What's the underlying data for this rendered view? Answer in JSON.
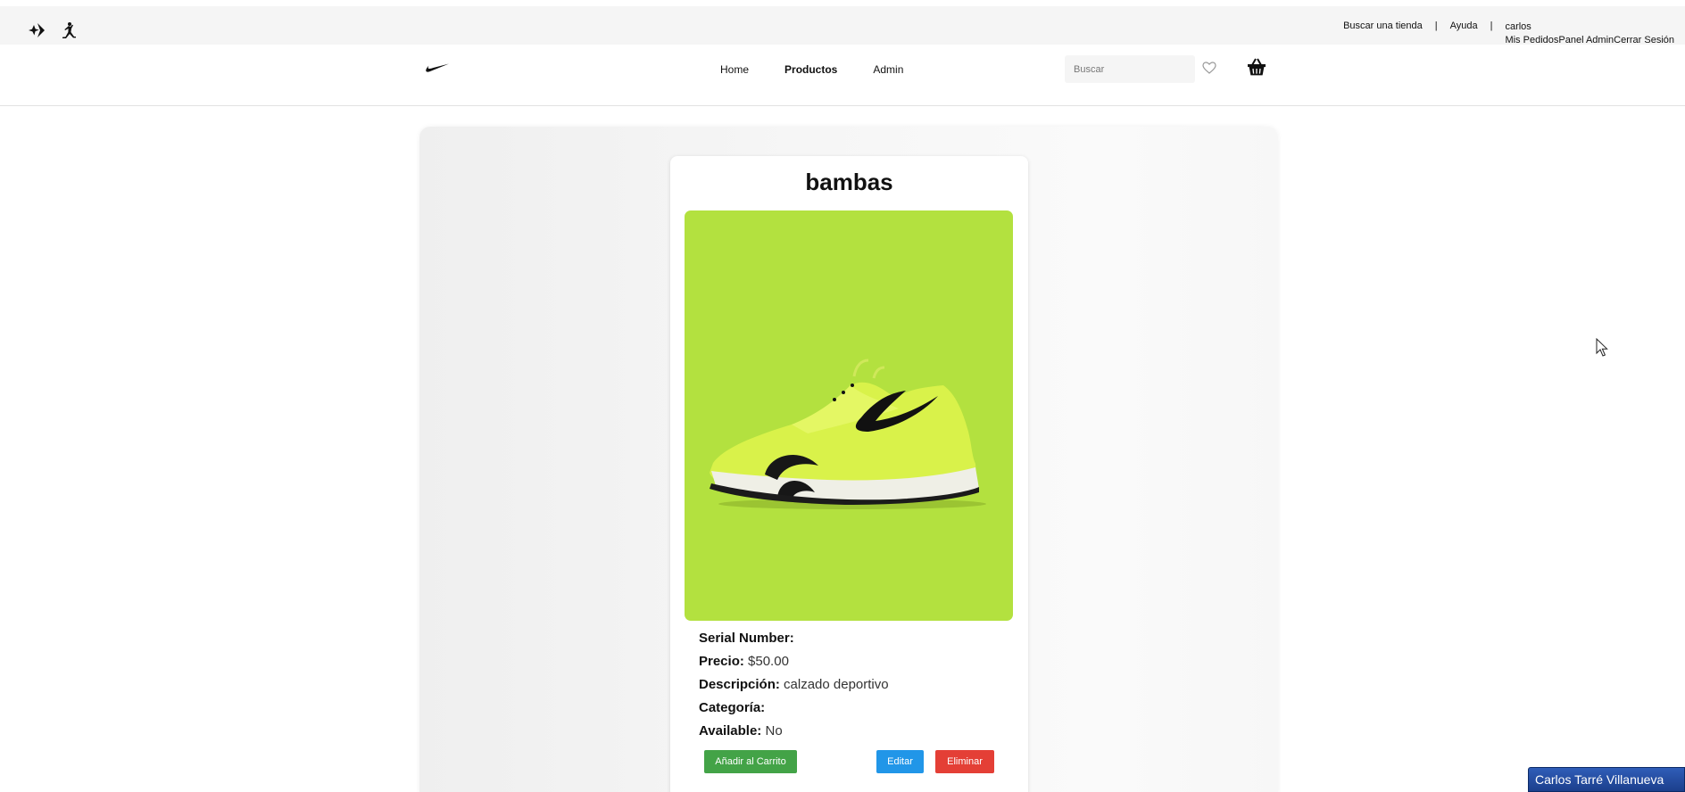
{
  "top_bar": {
    "find_store": "Buscar una tienda",
    "separator": "|",
    "help": "Ayuda",
    "username": "carlos",
    "my_orders": "Mis Pedidos",
    "admin_panel": "Panel Admin",
    "logout": "Cerrar Sesión",
    "icons": [
      "converse-icon",
      "jordan-icon"
    ]
  },
  "navbar": {
    "links": [
      {
        "label": "Home",
        "active": false
      },
      {
        "label": "Productos",
        "active": true
      },
      {
        "label": "Admin",
        "active": false
      }
    ],
    "search_placeholder": "Buscar",
    "icons": [
      "nike-logo-icon",
      "heart-icon",
      "shopping-basket-icon"
    ]
  },
  "product": {
    "title": "bambas",
    "image_background": "#b3e13f",
    "serial_label": "Serial Number:",
    "serial_value": "",
    "price_label": "Precio:",
    "price_value": "$50.00",
    "description_label": "Descripción:",
    "description_value": "calzado deportivo",
    "category_label": "Categoría:",
    "category_value": "",
    "available_label": "Available:",
    "available_value": "No"
  },
  "buttons": {
    "add_to_cart": "Añadir al Carrito",
    "edit": "Editar",
    "delete": "Eliminar"
  },
  "colors": {
    "add_to_cart": "#43a347",
    "edit": "#2196e8",
    "delete": "#e43f36"
  },
  "taskbar": {
    "user_name": "Carlos Tarré Villanueva"
  }
}
